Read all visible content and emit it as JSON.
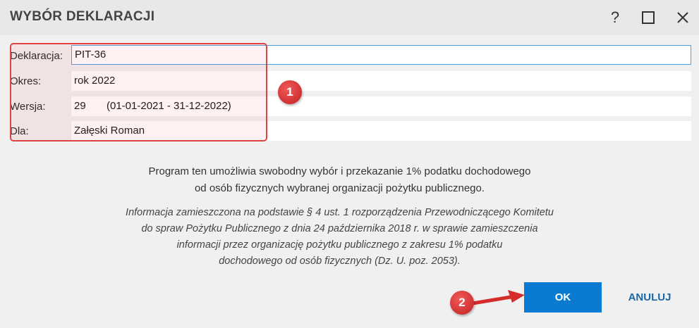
{
  "dialog": {
    "title": "WYBÓR DEKLARACJI",
    "help_icon": "question-mark-icon",
    "maximize_icon": "maximize-icon",
    "close_icon": "close-icon"
  },
  "form": {
    "declaration": {
      "label": "Deklaracja:",
      "value": "PIT-36"
    },
    "period": {
      "label": "Okres:",
      "value": "rok 2022"
    },
    "version": {
      "label": "Wersja:",
      "number": "29",
      "range": "(01-01-2021 - 31-12-2022)"
    },
    "for": {
      "label": "Dla:",
      "value": "Załęski Roman"
    }
  },
  "info": {
    "line1": "Program ten umożliwia swobodny wybór i przekazanie 1% podatku dochodowego",
    "line2": "od osób fizycznych wybranej organizacji pożytku publicznego.",
    "legal1": "Informacja zamieszczona na podstawie § 4 ust. 1 rozporządzenia Przewodniczącego Komitetu",
    "legal2": "do spraw Pożytku Publicznego z dnia 24 października 2018 r. w sprawie zamieszczenia",
    "legal3": "informacji przez organizację pożytku publicznego z zakresu 1% podatku",
    "legal4": "dochodowego od osób fizycznych (Dz. U. poz. 2053)."
  },
  "buttons": {
    "ok": "OK",
    "cancel": "ANULUJ"
  },
  "annotations": {
    "badge1": "1",
    "badge2": "2",
    "color": "#d62b2b"
  },
  "colors": {
    "accent": "#0a7bd0",
    "cancel_text": "#1a67a8",
    "highlight": "#e04343"
  }
}
